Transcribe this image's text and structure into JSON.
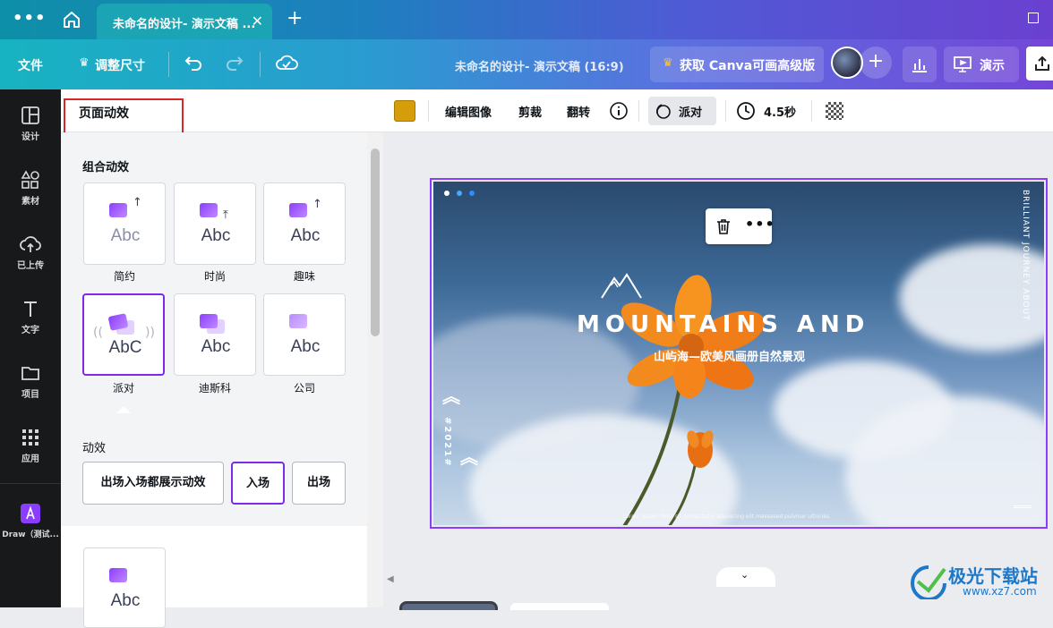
{
  "tabbar": {
    "tab_title": "未命名的设计- 演示文稿 ..."
  },
  "toolbar": {
    "file": "文件",
    "resize": "调整尺寸",
    "doc_title": "未命名的设计- 演示文稿 (16:9)",
    "upgrade": "获取 Canva可画高级版",
    "present": "演示"
  },
  "sidebar": {
    "items": [
      {
        "label": "设计",
        "icon": "layout-icon"
      },
      {
        "label": "素材",
        "icon": "shapes-icon"
      },
      {
        "label": "已上传",
        "icon": "upload-cloud-icon"
      },
      {
        "label": "文字",
        "icon": "text-icon"
      },
      {
        "label": "项目",
        "icon": "folder-icon"
      },
      {
        "label": "应用",
        "icon": "apps-grid-icon"
      },
      {
        "label": "Draw（测试...",
        "icon": "draw-app-icon"
      }
    ]
  },
  "panel": {
    "title": "页面动效",
    "combo_section": "组合动效",
    "cards": [
      {
        "label": "简约",
        "abc": "Abc"
      },
      {
        "label": "时尚",
        "abc": "Abc"
      },
      {
        "label": "趣味",
        "abc": "Abc"
      },
      {
        "label": "派对",
        "abc": "AbC"
      },
      {
        "label": "迪斯科",
        "abc": "Abc"
      },
      {
        "label": "公司",
        "abc": "Abc"
      }
    ],
    "anim_section": "动效",
    "anim_buttons": [
      "出场入场都展示动效",
      "入场",
      "出场"
    ],
    "lower_card_abc": "Abc"
  },
  "context_bar": {
    "swatch_color": "#d59d0a",
    "edit_image": "编辑图像",
    "crop": "剪裁",
    "flip": "翻转",
    "party": "派对",
    "duration": "4.5秒"
  },
  "design": {
    "title": "MOUNTAINS AND",
    "subtitle": "山屿海—欧美风画册自然景观",
    "vertical_text": "BRILLIANT JOURNEY ABOUT",
    "year": "#2021#",
    "lorem": "Lorem ipsum dolor sit consectetur adipiscing elit massased pulvinar ultricies."
  },
  "watermark": {
    "big": "极光下载站",
    "small": "www.xz7.com"
  }
}
